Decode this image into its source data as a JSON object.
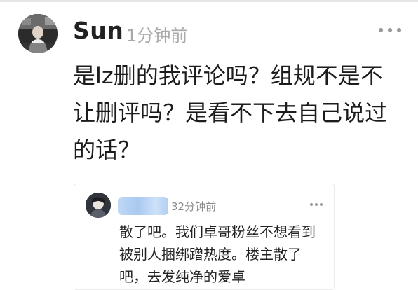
{
  "comment": {
    "username": "Sun",
    "time": "1分钟前",
    "text": "是lz删的我评论吗？组规不是不让删评吗？是看不下去自己说过的话？",
    "avatar_icon": "user-avatar-photo",
    "more_icon": "more-dots-icon"
  },
  "quoted": {
    "time": "32分钟前",
    "text": "散了吧。我们卓哥粉丝不想看到被别人捆绑蹭热度。楼主散了吧，去发纯净的爱卓",
    "avatar_icon": "user-avatar-photo",
    "more_icon": "more-dots-icon"
  },
  "colors": {
    "text": "#1c1c1c",
    "muted": "#a9a9a9",
    "blur": "#a9c9f0"
  }
}
